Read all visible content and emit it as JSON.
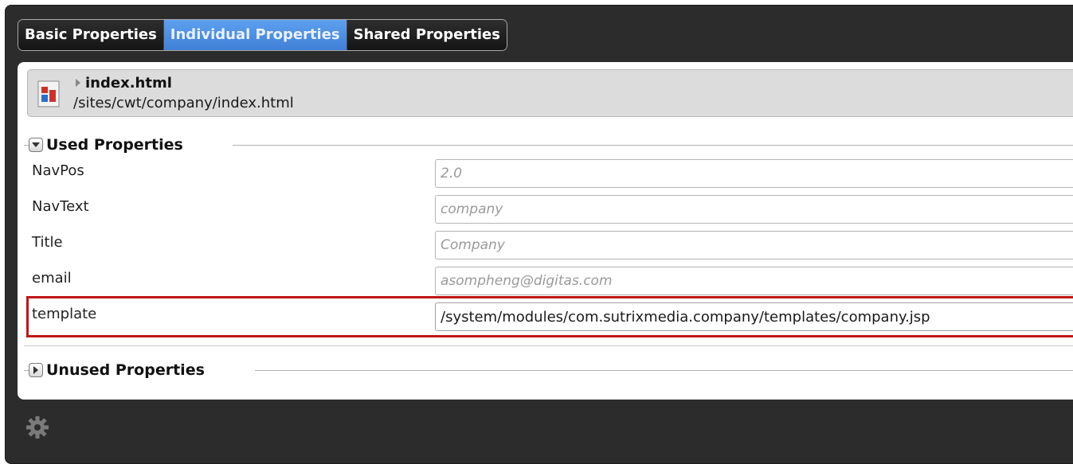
{
  "tabs": [
    {
      "label": "Basic Properties",
      "active": false
    },
    {
      "label": "Individual Properties",
      "active": true
    },
    {
      "label": "Shared Properties",
      "active": false
    }
  ],
  "file": {
    "name": "index.html",
    "path": "/sites/cwt/company/index.html",
    "icon": "html-page-icon"
  },
  "used_properties": {
    "title": "Used Properties",
    "toggle_icon": "collapse-arrow-icon",
    "rows": [
      {
        "label": "NavPos",
        "value": "2.0",
        "placeholder": true
      },
      {
        "label": "NavText",
        "value": "company",
        "placeholder": true
      },
      {
        "label": "Title",
        "value": "Company",
        "placeholder": true
      },
      {
        "label": "email",
        "value": "asompheng@digitas.com",
        "placeholder": true
      },
      {
        "label": "template",
        "value": "/system/modules/com.sutrixmedia.company/templates/company.jsp",
        "placeholder": false,
        "highlighted": true
      }
    ]
  },
  "unused_properties": {
    "title": "Unused Properties",
    "toggle_icon": "expand-arrow-icon"
  },
  "footer": {
    "settings_icon": "gear-icon"
  },
  "colors": {
    "active_tab": "#4f8fe3",
    "highlight_border": "#c01616",
    "frame_bg": "#2c2c2c"
  }
}
